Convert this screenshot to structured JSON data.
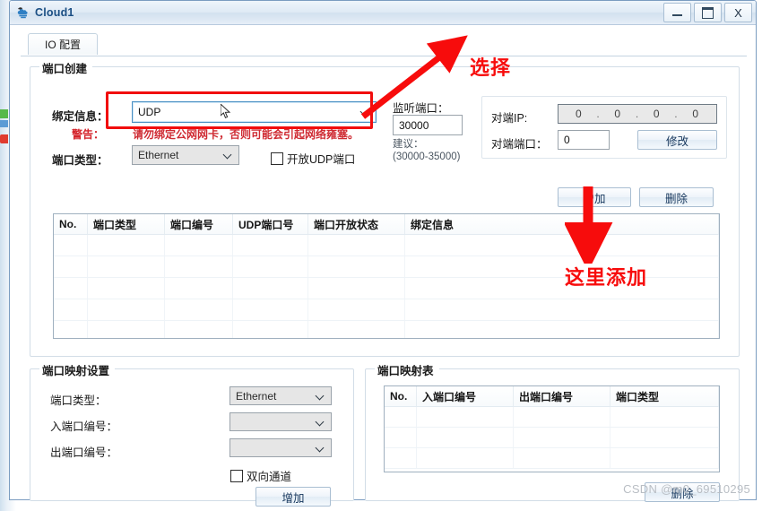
{
  "window": {
    "title": "Cloud1",
    "icon": "cloud-icon",
    "controls": {
      "minimize": "–",
      "maximize": "❐",
      "close": "X"
    }
  },
  "tabs": [
    {
      "label": "IO 配置",
      "active": true
    }
  ],
  "port_create": {
    "group_title": "端口创建",
    "binding_label": "绑定信息：",
    "binding_value": "UDP",
    "warning_prefix": "警告：",
    "warning_text": "请勿绑定公网网卡，否则可能会引起网络雍塞。",
    "port_type_label": "端口类型：",
    "port_type_value": "Ethernet",
    "open_udp_label": "开放UDP端口",
    "open_udp_checked": false,
    "listen_port_label": "监听端口：",
    "listen_port_value": "30000",
    "suggest_line1": "建议：",
    "suggest_line2": "(30000-35000)",
    "peer_ip_label": "对端IP:",
    "peer_ip_value": [
      "0",
      "0",
      "0",
      "0"
    ],
    "peer_port_label": "对端端口：",
    "peer_port_value": "0",
    "modify_button": "修改",
    "add_button": "增加",
    "delete_button": "删除",
    "table": {
      "columns": [
        "No.",
        "端口类型",
        "端口编号",
        "UDP端口号",
        "端口开放状态",
        "绑定信息"
      ],
      "rows": []
    }
  },
  "map_setting": {
    "group_title": "端口映射设置",
    "port_type_label": "端口类型：",
    "port_type_value": "Ethernet",
    "in_port_label": "入端口编号：",
    "in_port_value": "",
    "out_port_label": "出端口编号：",
    "out_port_value": "",
    "bidirectional_label": "双向通道",
    "bidirectional_checked": false,
    "add_button": "增加"
  },
  "map_table": {
    "group_title": "端口映射表",
    "columns": [
      "No.",
      "入端口编号",
      "出端口编号",
      "端口类型"
    ],
    "rows": [],
    "delete_button": "删除"
  },
  "annotations": [
    {
      "id": "select",
      "text": "选择"
    },
    {
      "id": "add-here",
      "text": "这里添加"
    }
  ],
  "watermark": "CSDN @m0_69510295",
  "colors": {
    "annotation_red": "#f70c0c",
    "title_blue": "#1b4f84",
    "warning_red": "#d4232b"
  }
}
